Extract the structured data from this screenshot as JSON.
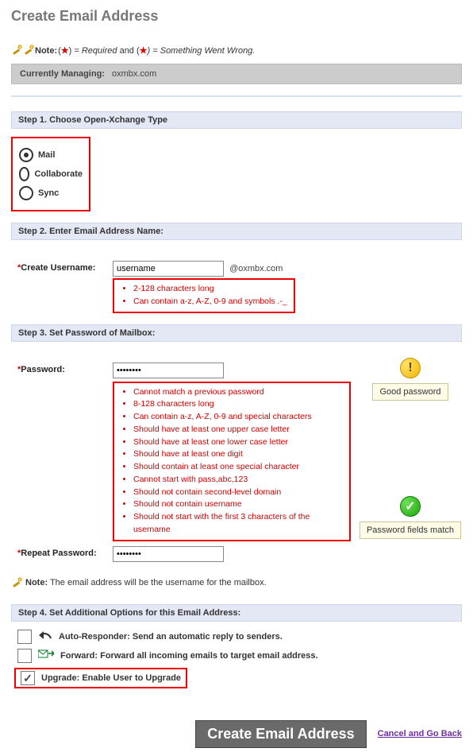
{
  "page_title": "Create Email Address",
  "note1_prefix": "Note:",
  "note1_req": " = Required",
  "note1_and": " and (",
  "note1_wrong": ") = Something Went Wrong.",
  "managing_label": "Currently Managing:",
  "managing_domain": "oxmbx.com",
  "step1": "Step 1. Choose Open-Xchange Type",
  "radios": {
    "mail": "Mail",
    "collab": "Collaborate",
    "sync": "Sync"
  },
  "step2": "Step 2. Enter Email Address Name:",
  "create_user_label": "Create Username:",
  "username_value": "username",
  "username_rules": [
    "2-128 characters long",
    "Can contain a-z, A-Z, 0-9 and symbols .-_"
  ],
  "step3": "Step 3. Set Password of Mailbox:",
  "password_label": "Password:",
  "password_value": "••••••••",
  "good_pw": "Good password",
  "pw_rules": [
    "Cannot match a previous password",
    "8-128 characters long",
    "Can contain a-z, A-Z, 0-9 and special characters",
    "Should have at least one upper case letter",
    "Should have at least one lower case letter",
    "Should have at least one digit",
    "Should contain at least one special character",
    "Cannot start with pass,abc,123",
    "Should not contain second-level domain",
    "Should not contain username",
    "Should not start with the first 3 characters of the username"
  ],
  "repeat_label": "Repeat Password:",
  "repeat_value": "••••••••",
  "pw_match": "Password fields match",
  "note2_prefix": "Note:",
  "note2_text": " The email address will be the username for the mailbox.",
  "step4": "Step 4. Set Additional Options for this Email Address:",
  "opt_auto": "Auto-Responder: Send an automatic reply to senders.",
  "opt_fwd": "Forward: Forward all incoming emails to target email address.",
  "opt_upgrade": "Upgrade: Enable User to Upgrade",
  "create_btn": "Create Email Address",
  "cancel_link": "Cancel and Go Back",
  "at_domain": "@oxmbx.com"
}
